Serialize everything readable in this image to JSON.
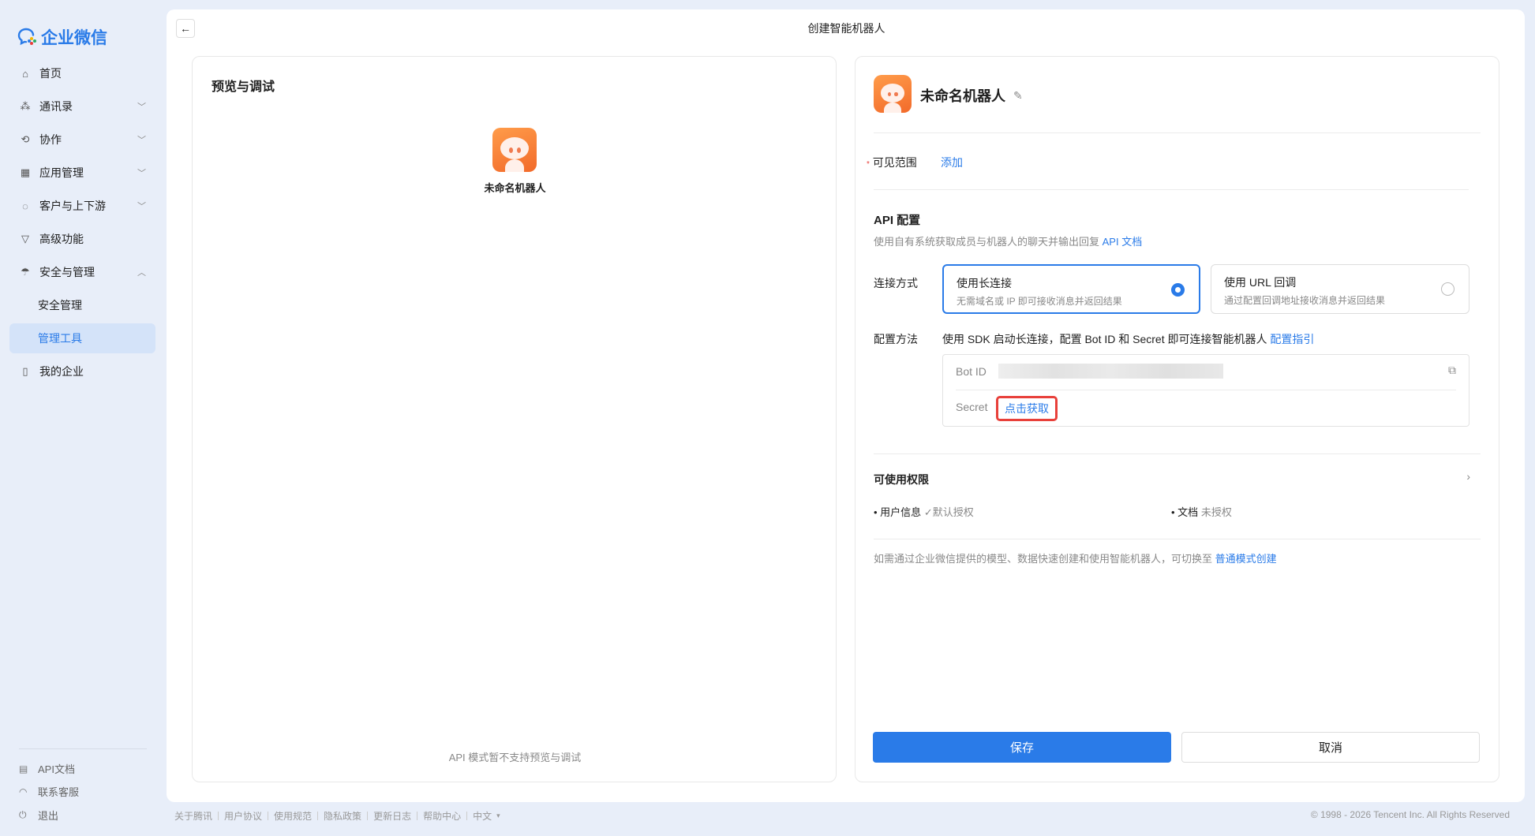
{
  "app": {
    "logo_text": "企业微信",
    "page_title": "创建智能机器人"
  },
  "sidebar": {
    "items": [
      {
        "label": "首页",
        "icon": "home-icon"
      },
      {
        "label": "通讯录",
        "icon": "org-icon",
        "chevron": "down"
      },
      {
        "label": "协作",
        "icon": "collab-icon",
        "chevron": "down"
      },
      {
        "label": "应用管理",
        "icon": "apps-icon",
        "chevron": "down"
      },
      {
        "label": "客户与上下游",
        "icon": "chat-icon",
        "chevron": "down"
      },
      {
        "label": "高级功能",
        "icon": "advanced-icon"
      },
      {
        "label": "安全与管理",
        "icon": "umbrella-icon",
        "chevron": "up"
      },
      {
        "label": "安全管理"
      },
      {
        "label": "管理工具",
        "active": true
      },
      {
        "label": "我的企业",
        "icon": "building-icon"
      }
    ],
    "bottom": [
      {
        "label": "API文档"
      },
      {
        "label": "联系客服"
      },
      {
        "label": "退出"
      }
    ]
  },
  "preview": {
    "title": "预览与调试",
    "bot_name": "未命名机器人",
    "notice": "API 模式暂不支持预览与调试"
  },
  "config": {
    "bot_name": "未命名机器人",
    "visibility": {
      "label": "可见范围",
      "action": "添加"
    },
    "api": {
      "title": "API 配置",
      "desc": "使用自有系统获取成员与机器人的聊天并输出回复",
      "desc_link": "API 文档",
      "conn_label": "连接方式",
      "options": [
        {
          "title": "使用长连接",
          "desc": "无需域名或 IP 即可接收消息并返回结果",
          "selected": true
        },
        {
          "title": "使用 URL 回调",
          "desc": "通过配置回调地址接收消息并返回结果",
          "selected": false
        }
      ],
      "method_label": "配置方法",
      "method_text": "使用 SDK 启动长连接，配置 Bot ID 和 Secret 即可连接智能机器人",
      "method_link": "配置指引",
      "bot_id_label": "Bot ID",
      "secret_label": "Secret",
      "secret_action": "点击获取"
    },
    "permissions": {
      "title": "可使用权限",
      "items": [
        {
          "name": "用户信息",
          "status": "✓默认授权"
        },
        {
          "name": "文档",
          "status": "未授权"
        }
      ]
    },
    "note": "如需通过企业微信提供的模型、数据快速创建和使用智能机器人，可切换至",
    "note_link": "普通模式创建",
    "save": "保存",
    "cancel": "取消"
  },
  "footer": {
    "links": [
      "关于腾讯",
      "用户协议",
      "使用规范",
      "隐私政策",
      "更新日志",
      "帮助中心",
      "中文"
    ],
    "copyright": "© 1998 - 2026 Tencent Inc. All Rights Reserved"
  },
  "colors": {
    "accent": "#2a7be8",
    "highlight": "#e8403a"
  }
}
